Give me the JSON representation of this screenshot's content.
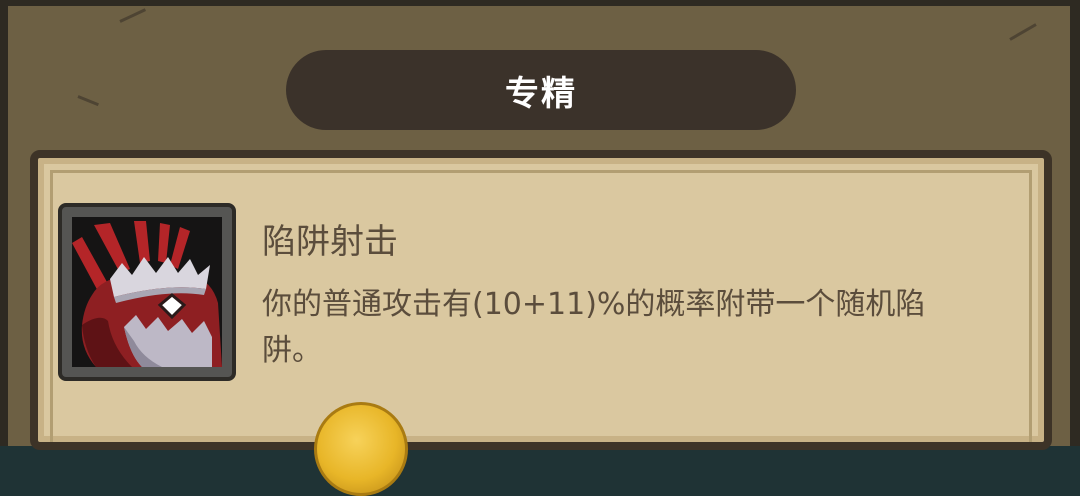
{
  "panel": {
    "title": "专精"
  },
  "skill": {
    "name": "陷阱射击",
    "description": "你的普通攻击有(10+11)%的概率附带一个随机陷阱。",
    "icon": "trap-jaw-icon"
  },
  "colors": {
    "frame": "#6d6044",
    "banner": "#3b322a",
    "parchment": "#dac8a0",
    "text": "#5b4d3c",
    "icon_red": "#8e1f22",
    "coin_gold": "#e8b628"
  }
}
